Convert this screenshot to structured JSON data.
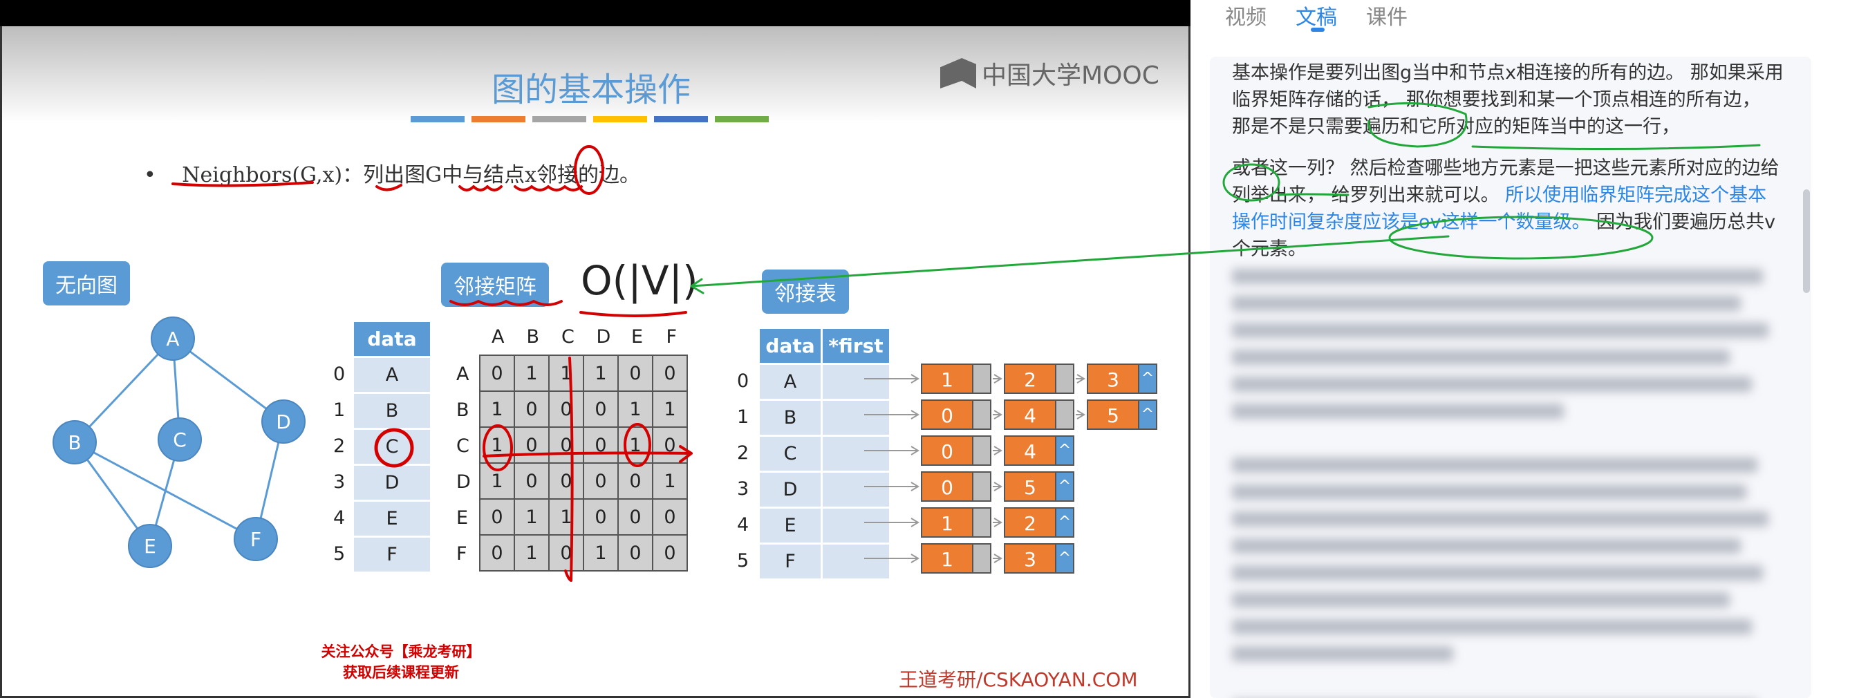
{
  "slide": {
    "title": "图的基本操作",
    "color_bars": [
      "#5b9bd5",
      "#ed7d31",
      "#a5a5a5",
      "#ffc000",
      "#4472c4",
      "#70ad47"
    ],
    "logo_text": "中国大学MOOC",
    "bullet": {
      "dot": "•",
      "text": "Neighbors(G,x)：列出图G中与结点x邻接的边。"
    },
    "callouts": {
      "undirected": "无向图",
      "matrix": "邻接矩阵",
      "list": "邻接表"
    },
    "complexity": "O(|V|)",
    "graph": {
      "nodes": [
        "A",
        "B",
        "C",
        "D",
        "E",
        "F"
      ],
      "edges": [
        [
          "A",
          "B"
        ],
        [
          "A",
          "C"
        ],
        [
          "A",
          "D"
        ],
        [
          "B",
          "E"
        ],
        [
          "B",
          "F"
        ],
        [
          "C",
          "E"
        ],
        [
          "D",
          "F"
        ]
      ]
    },
    "matrix": {
      "index_labels": [
        "0",
        "1",
        "2",
        "3",
        "4",
        "5"
      ],
      "data_header": "data",
      "data": [
        "A",
        "B",
        "C",
        "D",
        "E",
        "F"
      ],
      "col_headers": [
        "A",
        "B",
        "C",
        "D",
        "E",
        "F"
      ],
      "row_headers": [
        "A",
        "B",
        "C",
        "D",
        "E",
        "F"
      ],
      "rows": [
        [
          "0",
          "1",
          "1",
          "1",
          "0",
          "0"
        ],
        [
          "1",
          "0",
          "0",
          "0",
          "1",
          "1"
        ],
        [
          "1",
          "0",
          "0",
          "0",
          "1",
          "0"
        ],
        [
          "1",
          "0",
          "0",
          "0",
          "0",
          "1"
        ],
        [
          "0",
          "1",
          "1",
          "0",
          "0",
          "0"
        ],
        [
          "0",
          "1",
          "0",
          "1",
          "0",
          "0"
        ]
      ]
    },
    "adj_list": {
      "headers": [
        "data",
        "*first"
      ],
      "index_labels": [
        "0",
        "1",
        "2",
        "3",
        "4",
        "5"
      ],
      "data": [
        "A",
        "B",
        "C",
        "D",
        "E",
        "F"
      ],
      "chains": [
        [
          "1",
          "2",
          "3"
        ],
        [
          "0",
          "4",
          "5"
        ],
        [
          "0",
          "4"
        ],
        [
          "0",
          "5"
        ],
        [
          "1",
          "2"
        ],
        [
          "1",
          "3"
        ]
      ],
      "null_symbol": "^"
    },
    "footer_red": [
      "关注公众号【乘龙考研】",
      "获取后续课程更新"
    ],
    "footer_brand": "王道考研/CSKAOYAN.COM"
  },
  "panel": {
    "tabs": [
      "视频",
      "文稿",
      "课件"
    ],
    "active_tab": "文稿",
    "accent": "#2c86e6",
    "para1": "基本操作是要列出图g当中和节点x相连接的所有的边。 那如果采用临界矩阵存储的话， 那你想要找到和某一个顶点相连的所有边， 那是不是只需要遍历和它所对应的矩阵当中的这一行，",
    "para2_plain": "或者这一列？ 然后检查哪些地方元素是一把这些元素所对应的边给列举出来， 给罗列出来就可以。 ",
    "para2_highlight": "所以使用临界矩阵完成这个基本操作时间复杂度应该是ov这样一个数量级。",
    "para2_tail": " 因为我们要遍历总共v个元素。"
  }
}
